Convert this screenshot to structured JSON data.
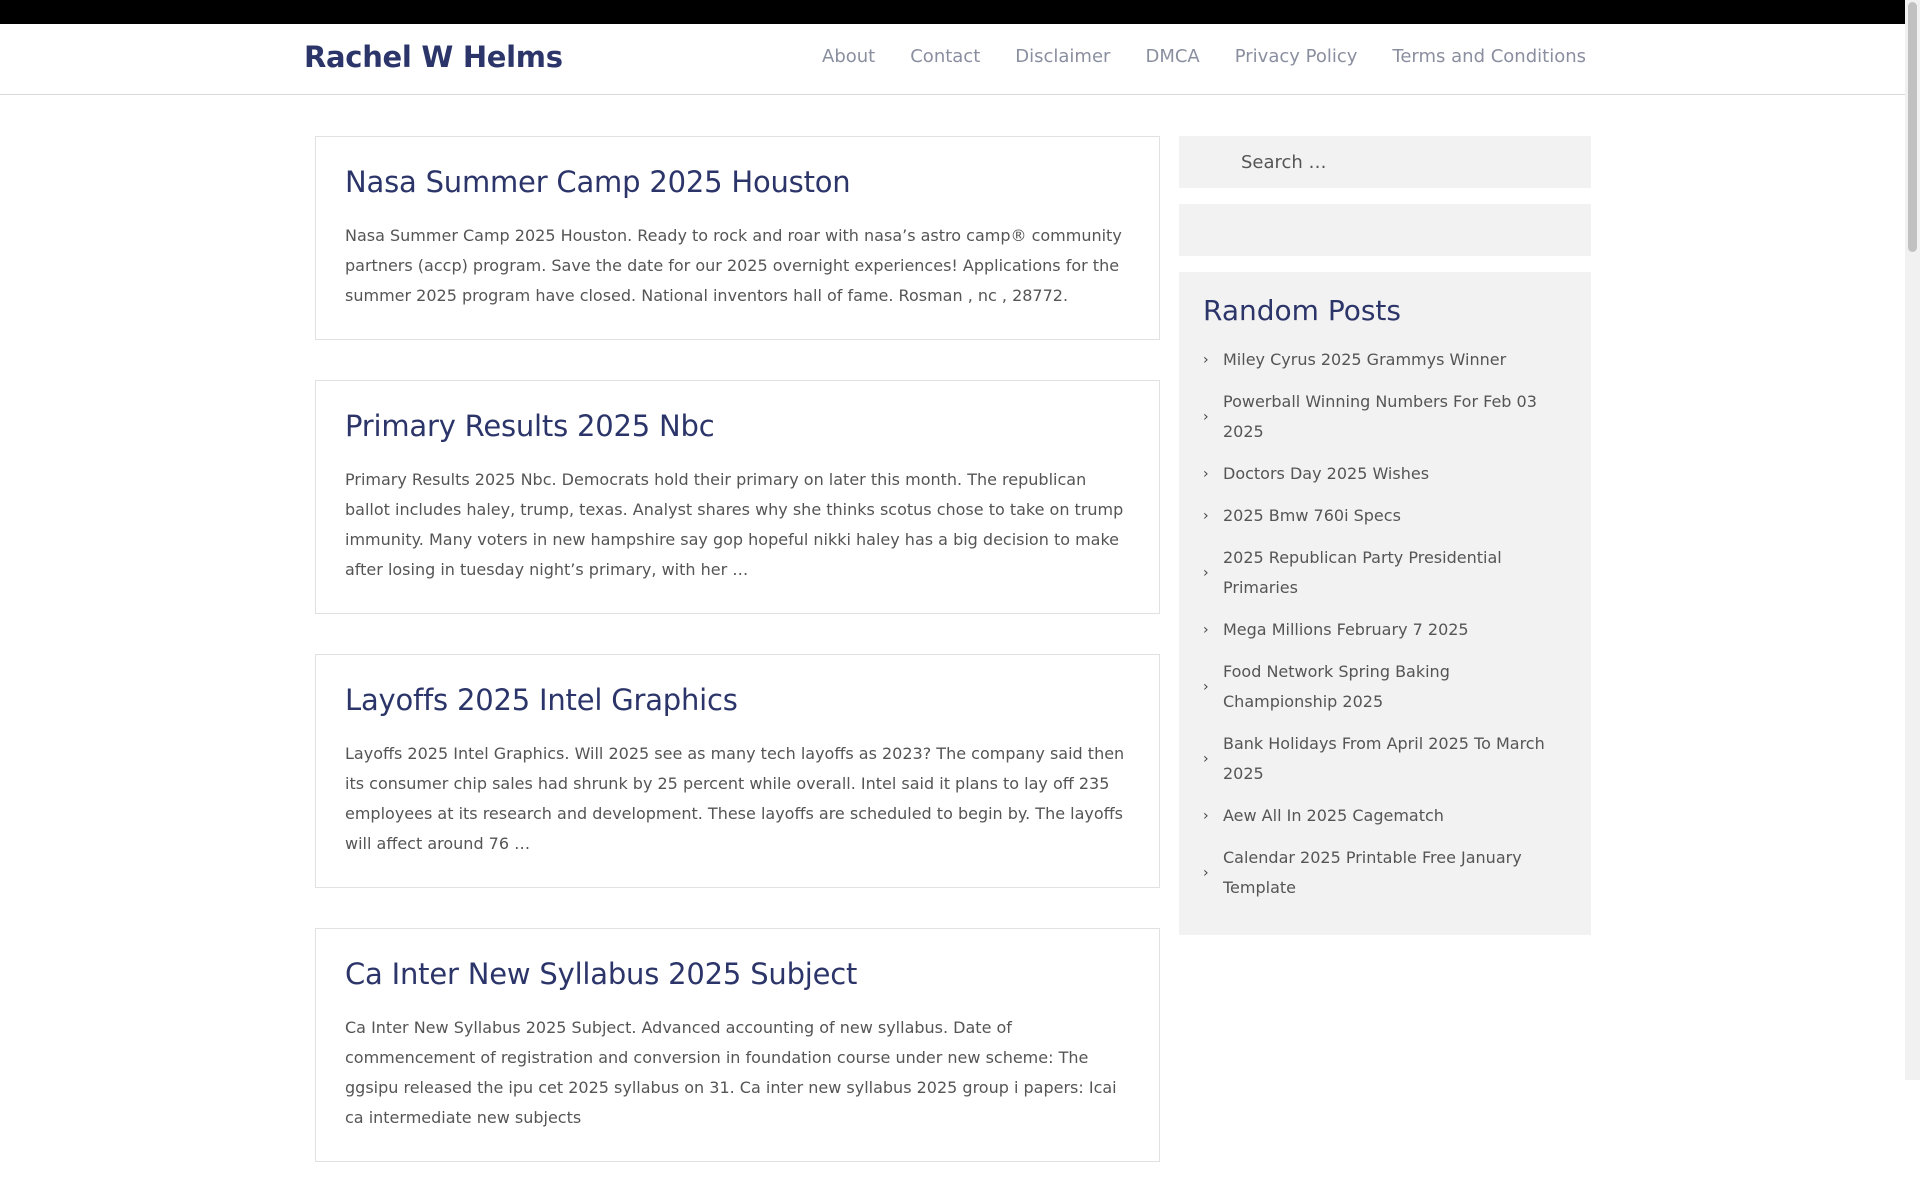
{
  "site": {
    "title": "Rachel W Helms",
    "nav": [
      "About",
      "Contact",
      "Disclaimer",
      "DMCA",
      "Privacy Policy",
      "Terms and Conditions"
    ]
  },
  "posts": [
    {
      "title": "Nasa Summer Camp 2025 Houston",
      "excerpt": "Nasa Summer Camp 2025 Houston. Ready to rock and roar with nasa’s astro camp® community partners (accp) program. Save the date for our 2025 overnight experiences! Applications for the summer 2025 program have closed. National inventors hall of fame. Rosman , nc , 28772."
    },
    {
      "title": "Primary Results 2025 Nbc",
      "excerpt": "Primary Results 2025 Nbc. Democrats hold their primary on later this month. The republican ballot includes haley, trump, texas. Analyst shares why she thinks scotus chose to take on trump immunity. Many voters in new hampshire say gop hopeful nikki haley has a big decision to make after losing in tuesday night’s primary, with her …"
    },
    {
      "title": "Layoffs 2025 Intel Graphics",
      "excerpt": "Layoffs 2025 Intel Graphics. Will 2025 see as many tech layoffs as 2023? The company said then its consumer chip sales had shrunk by 25 percent while overall. Intel said it plans to lay off 235 employees at its research and development. These layoffs are scheduled to begin by. The layoffs will affect around 76 …"
    },
    {
      "title": "Ca Inter New Syllabus 2025 Subject",
      "excerpt": "Ca Inter New Syllabus 2025 Subject. Advanced accounting of new syllabus. Date of commencement of registration and conversion in foundation course under new scheme: The ggsipu released the ipu cet 2025 syllabus on 31. Ca inter new syllabus 2025 group i papers: Icai ca intermediate new subjects"
    }
  ],
  "sidebar": {
    "search_placeholder": "Search …",
    "random_posts": {
      "title": "Random Posts",
      "items": [
        "Miley Cyrus 2025 Grammys Winner",
        "Powerball Winning Numbers For Feb 03 2025",
        "Doctors Day 2025 Wishes",
        "2025 Bmw 760i Specs",
        "2025 Republican Party Presidential Primaries",
        "Mega Millions February 7 2025",
        "Food Network Spring Baking Championship 2025",
        "Bank Holidays From April 2025 To March 2025",
        "Aew All In 2025 Cagematch",
        "Calendar 2025 Printable Free January Template"
      ]
    }
  },
  "icons": {
    "list_bullet": "chevron-right-icon"
  }
}
